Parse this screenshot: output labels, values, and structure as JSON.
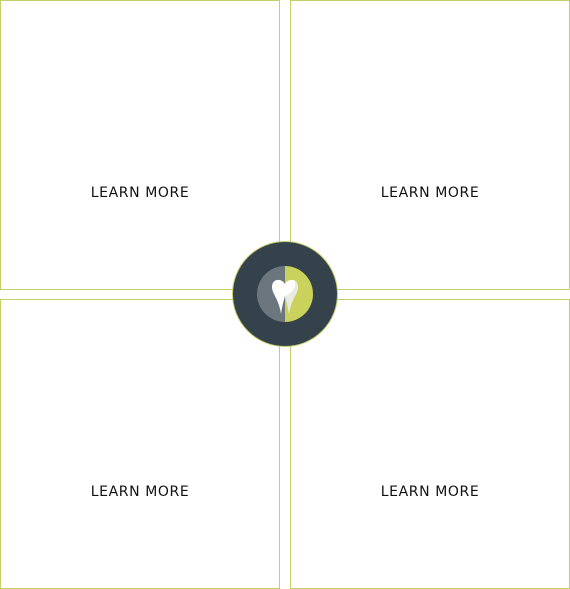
{
  "cards": [
    {
      "link_label": "LEARN MORE"
    },
    {
      "link_label": "LEARN MORE"
    },
    {
      "link_label": "LEARN MORE"
    },
    {
      "link_label": "LEARN MORE"
    }
  ],
  "colors": {
    "border_accent": "#c4cf6a",
    "badge_background": "#35424c",
    "icon_gray": "#6b767e",
    "icon_green": "#c9d25a",
    "icon_white": "#ffffff"
  },
  "badge": {
    "icon": "tooth-heart-icon"
  }
}
